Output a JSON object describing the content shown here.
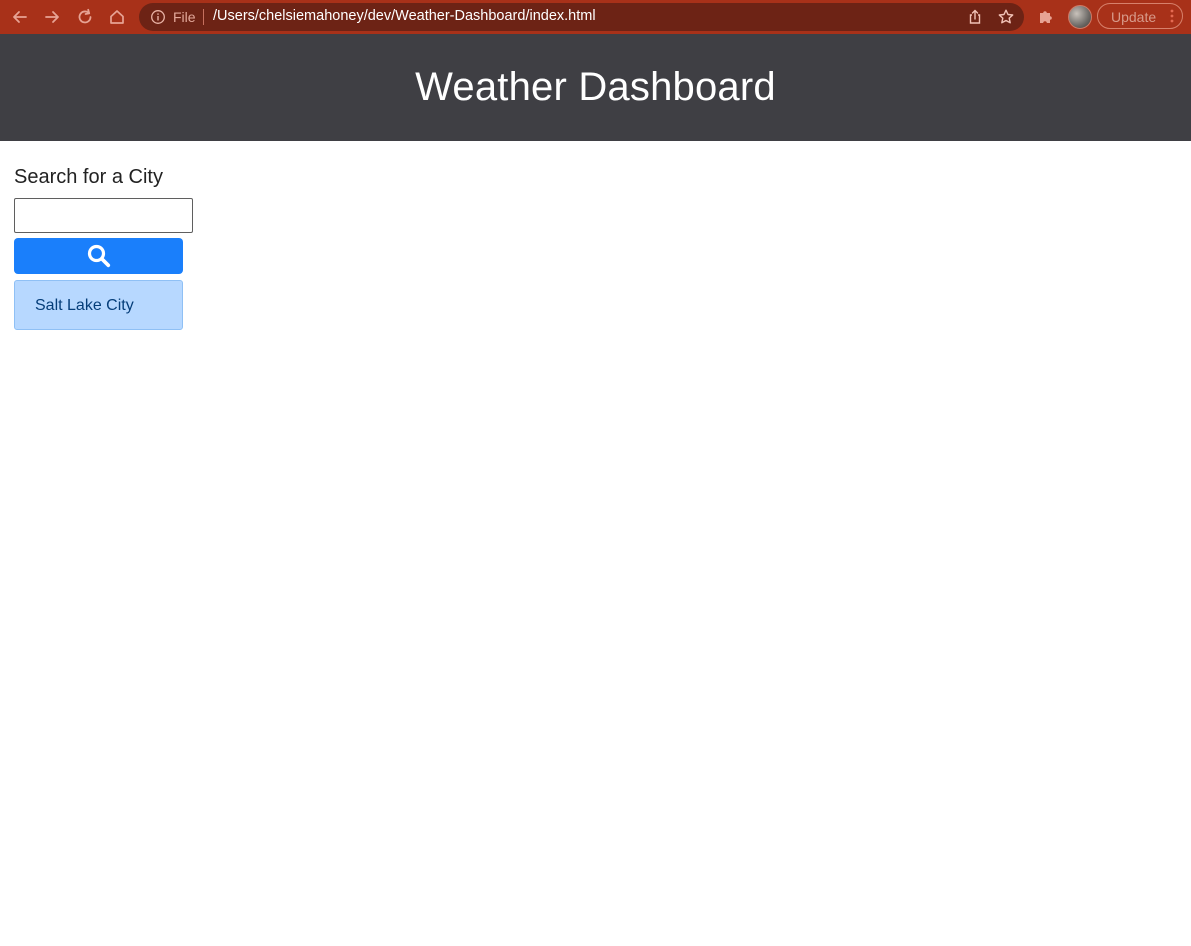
{
  "browser": {
    "file_label": "File",
    "url": "/Users/chelsiemahoney/dev/Weather-Dashboard/index.html",
    "update_label": "Update",
    "icons": [
      "back-arrow-icon",
      "forward-arrow-icon",
      "reload-icon",
      "home-icon",
      "info-icon",
      "share-icon",
      "star-icon",
      "extensions-puzzle-icon",
      "menu-dots-icon"
    ],
    "accent_color": "#a83119"
  },
  "header": {
    "title": "Weather Dashboard",
    "background": "#3f3f44"
  },
  "sidebar": {
    "heading": "Search for a City",
    "search_input": {
      "value": "",
      "placeholder": ""
    },
    "search_button_icon": "search-icon",
    "search_button_color": "#1a7ffb",
    "history": [
      {
        "label": "Salt Lake City"
      }
    ]
  }
}
